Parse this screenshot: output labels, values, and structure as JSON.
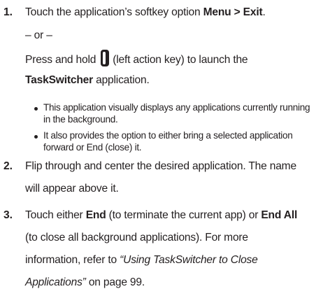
{
  "step1": {
    "number": "1.",
    "line1_prefix": "Touch the application’s softkey option ",
    "line1_bold": "Menu > Exit",
    "line1_suffix": ".",
    "or_text": "– or –",
    "line3_prefix": "Press and hold",
    "line3_suffix": "(left action key) to launch the",
    "line4_bold": "TaskSwitcher",
    "line4_suffix": " application."
  },
  "bullets": [
    {
      "line1": "This application visually displays any applications currently running",
      "line2": "in the background."
    },
    {
      "line1": "It also provides the option to either bring a selected application",
      "line2": "forward or End (close) it."
    }
  ],
  "step2": {
    "number": "2.",
    "line1": "Flip through and center the desired application. The name",
    "line2": "will appear above it."
  },
  "step3": {
    "number": "3.",
    "l1_a": "Touch either ",
    "l1_b": "End",
    "l1_c": " (to terminate the current app) or ",
    "l1_d": "End All",
    "line2": "(to close all background applications). For more",
    "l3_a": "information, refer to ",
    "l3_b": "“Using TaskSwitcher to Close",
    "l4_a": "Applications”",
    "l4_b": "  on page 99."
  },
  "icons": {
    "left_action_key": "left-action-key-icon"
  }
}
